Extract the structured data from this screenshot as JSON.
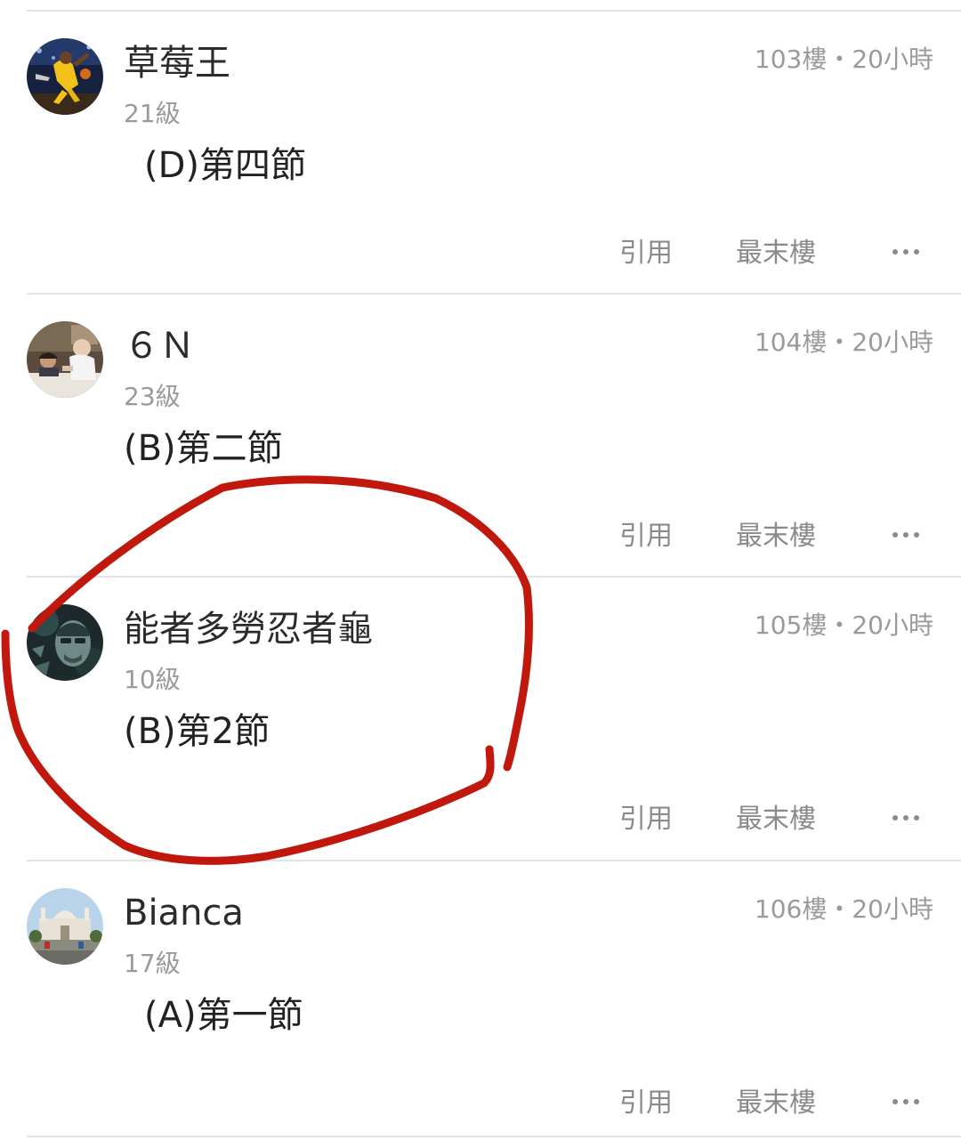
{
  "posts": [
    {
      "username": "草莓王",
      "level": "21級",
      "floor": "103樓",
      "time": "20小時",
      "content": "(D)第四節",
      "avatar_icon": "basketball-player-avatar"
    },
    {
      "username": "６Ｎ",
      "level": "23級",
      "floor": "104樓",
      "time": "20小時",
      "content": "(B)第二節",
      "avatar_icon": "photo-of-children-avatar"
    },
    {
      "username": "能者多勞忍者龜",
      "level": "10級",
      "floor": "105樓",
      "time": "20小時",
      "content": "(B)第2節",
      "avatar_icon": "portrait-illustration-avatar"
    },
    {
      "username": "Bianca",
      "level": "17級",
      "floor": "106樓",
      "time": "20小時",
      "content": "(A)第一節",
      "avatar_icon": "landmark-building-avatar"
    }
  ],
  "actions": {
    "quote_label": "引用",
    "last_floor_label": "最末樓",
    "separator": "・"
  },
  "colors": {
    "annotation_stroke": "#c0180c",
    "text_primary": "#2b2b2b",
    "text_secondary": "#9a9a9a",
    "divider": "#e3e3e3"
  }
}
